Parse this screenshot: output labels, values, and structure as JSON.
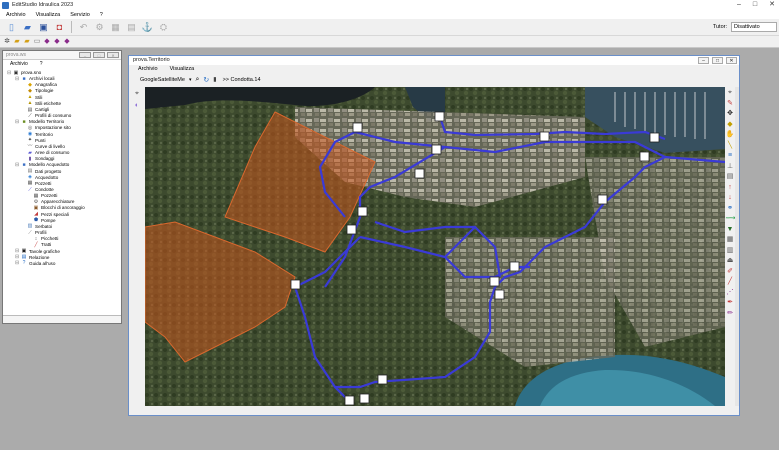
{
  "window": {
    "title": "EditStudio Idraulica 2023"
  },
  "menubar": {
    "items": [
      "Archivio",
      "Visualizza",
      "Servizio",
      "?"
    ]
  },
  "tutor": {
    "label": "Tutor:",
    "value": "Disattivato"
  },
  "tree_panel": {
    "title": "prova.ws",
    "menu": [
      "Archivio",
      "?"
    ],
    "nodes": [
      {
        "label": "prova.sno",
        "depth": 0,
        "icon": "project-icon",
        "sym": "▣",
        "color": "#333"
      },
      {
        "label": "Archivi locali",
        "depth": 1,
        "icon": "folder-icon",
        "sym": "■",
        "color": "#3b6fc4"
      },
      {
        "label": "Anagrafica",
        "depth": 2,
        "icon": "registry-icon",
        "sym": "◆",
        "color": "#d9a300"
      },
      {
        "label": "Tipologie",
        "depth": 2,
        "icon": "types-icon",
        "sym": "◆",
        "color": "#c48a00"
      },
      {
        "label": "Stili",
        "depth": 2,
        "icon": "styles-icon",
        "sym": "▲",
        "color": "#c2a000"
      },
      {
        "label": "Stili etichette",
        "depth": 2,
        "icon": "label-styles-icon",
        "sym": "▲",
        "color": "#b39200"
      },
      {
        "label": "Cartigli",
        "depth": 2,
        "icon": "title-block-icon",
        "sym": "▤",
        "color": "#555"
      },
      {
        "label": "Profili di consumo",
        "depth": 2,
        "icon": "consumption-profile-icon",
        "sym": "⟋",
        "color": "#333"
      },
      {
        "label": "Modello Territorio",
        "depth": 1,
        "icon": "terrain-model-icon",
        "sym": "■",
        "color": "#6b8e23"
      },
      {
        "label": "Impostazione sito",
        "depth": 2,
        "icon": "site-settings-icon",
        "sym": "◎",
        "color": "#555"
      },
      {
        "label": "Territorio",
        "depth": 2,
        "icon": "territory-icon",
        "sym": "◉",
        "color": "#2a7bd4"
      },
      {
        "label": "Punti",
        "depth": 2,
        "icon": "points-icon",
        "sym": "✦",
        "color": "#333"
      },
      {
        "label": "Curve di livello",
        "depth": 2,
        "icon": "contour-icon",
        "sym": "〰",
        "color": "#777"
      },
      {
        "label": "Aree di consumo",
        "depth": 2,
        "icon": "consumption-areas-icon",
        "sym": "▰",
        "color": "#5b5bd6"
      },
      {
        "label": "Sondaggi",
        "depth": 2,
        "icon": "surveys-icon",
        "sym": "▮",
        "color": "#6a4fa3"
      },
      {
        "label": "Modello Acquedotto",
        "depth": 1,
        "icon": "aqueduct-model-icon",
        "sym": "■",
        "color": "#3b6fc4"
      },
      {
        "label": "Dati progetto",
        "depth": 2,
        "icon": "project-data-icon",
        "sym": "▤",
        "color": "#777"
      },
      {
        "label": "Acquedotto",
        "depth": 2,
        "icon": "aqueduct-icon",
        "sym": "◈",
        "color": "#2a7bd4"
      },
      {
        "label": "Pozzetti",
        "depth": 2,
        "icon": "manholes-icon",
        "sym": "▦",
        "color": "#5a5a5a"
      },
      {
        "label": "Condotte",
        "depth": 2,
        "icon": "pipes-icon",
        "sym": "⟋",
        "color": "#3b3bcf"
      },
      {
        "label": "Pozzetti",
        "depth": 3,
        "icon": "manhole-icon",
        "sym": "▦",
        "color": "#5a5a5a"
      },
      {
        "label": "Apparecchiature",
        "depth": 3,
        "icon": "equipment-icon",
        "sym": "⚙",
        "color": "#555"
      },
      {
        "label": "Blocchi di ancoraggio",
        "depth": 3,
        "icon": "anchor-blocks-icon",
        "sym": "▣",
        "color": "#8a5a2a"
      },
      {
        "label": "Pezzi speciali",
        "depth": 3,
        "icon": "special-pieces-icon",
        "sym": "◢",
        "color": "#c23b3b"
      },
      {
        "label": "Pompe",
        "depth": 3,
        "icon": "pumps-icon",
        "sym": "⬟",
        "color": "#2a5aa8"
      },
      {
        "label": "Serbatoi",
        "depth": 2,
        "icon": "tanks-icon",
        "sym": "▥",
        "color": "#4a7ab8"
      },
      {
        "label": "Profili",
        "depth": 2,
        "icon": "profiles-icon",
        "sym": "⟋",
        "color": "#777"
      },
      {
        "label": "Picchetti",
        "depth": 3,
        "icon": "stakes-icon",
        "sym": "↕",
        "color": "#444"
      },
      {
        "label": "Tratti",
        "depth": 3,
        "icon": "sections-icon",
        "sym": "╱",
        "color": "#c23b3b"
      },
      {
        "label": "Tavole grafiche",
        "depth": 1,
        "icon": "drawings-icon",
        "sym": "▣",
        "color": "#222"
      },
      {
        "label": "Relazione",
        "depth": 1,
        "icon": "report-icon",
        "sym": "▤",
        "color": "#2a6fc4"
      },
      {
        "label": "Guida all'uso",
        "depth": 1,
        "icon": "help-guide-icon",
        "sym": "?",
        "color": "#2a6fc4"
      }
    ]
  },
  "map_window": {
    "title": "prova.Territorio",
    "menu": [
      "Archivio",
      "Visualizza"
    ],
    "layer": "GoogleSatelliteMe",
    "breadcrumb": ">> Condotta.14"
  }
}
